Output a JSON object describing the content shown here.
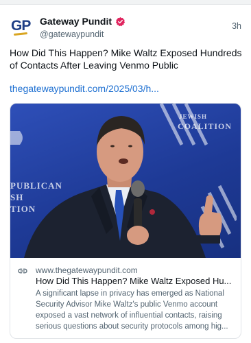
{
  "post": {
    "author": {
      "display_name": "Gateway Pundit",
      "handle": "@gatewaypundit",
      "avatar_text": "GP",
      "verified_icon": "verified-badge-icon"
    },
    "time": "3h",
    "text": "How Did This Happen? Mike Waltz Exposed Hundreds of Contacts After Leaving Venmo Public",
    "link_text": "thegatewaypundit.com/2025/03/h..."
  },
  "card": {
    "image_alt": "photo",
    "backdrop_text": {
      "line1": "PUBLICAN",
      "line2": "SH",
      "line3": "TION",
      "jewish": "JEWISH",
      "coalition": "COALITION"
    },
    "domain": "www.thegatewaypundit.com",
    "title": "How Did This Happen? Mike Waltz Exposed Hu...",
    "description": "A significant lapse in privacy has emerged as National Security Advisor Mike Waltz's public Venmo account exposed a vast network of influential contacts, raising serious questions about security protocols among hig..."
  },
  "colors": {
    "link": "#1d6fd1",
    "verified": "#e0245e",
    "backdrop": "#2e4fb8"
  }
}
